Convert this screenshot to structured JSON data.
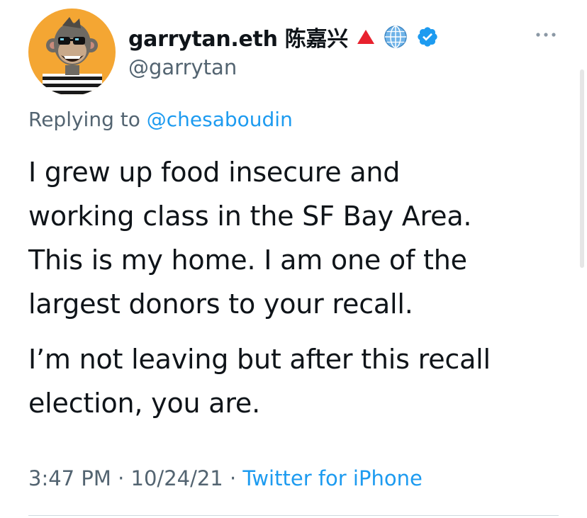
{
  "tweet": {
    "author": {
      "display_name": "garrytan.eth 陈嘉兴",
      "handle": "@garrytan",
      "avatar_icon": "ape-avatar-icon",
      "badges": [
        "red-triangle-icon",
        "globe-icon",
        "verified-badge-icon"
      ]
    },
    "reply": {
      "prefix": "Replying to",
      "mention": "@chesaboudin"
    },
    "paragraphs": [
      "I grew up food insecure and\nworking class in the SF Bay Area.\nThis is my home. I am one of the\nlargest donors to your recall.",
      "I’m not leaving but after this recall\nelection, you are."
    ],
    "meta": {
      "time": "3:47 PM",
      "separator": "·",
      "date": "10/24/21",
      "source": "Twitter for iPhone"
    }
  },
  "colors": {
    "text": "#0f1419",
    "secondary": "#536471",
    "link": "#1d9bf0",
    "verified": "#1d9bf0",
    "avatar_bg": "#f4a633"
  }
}
